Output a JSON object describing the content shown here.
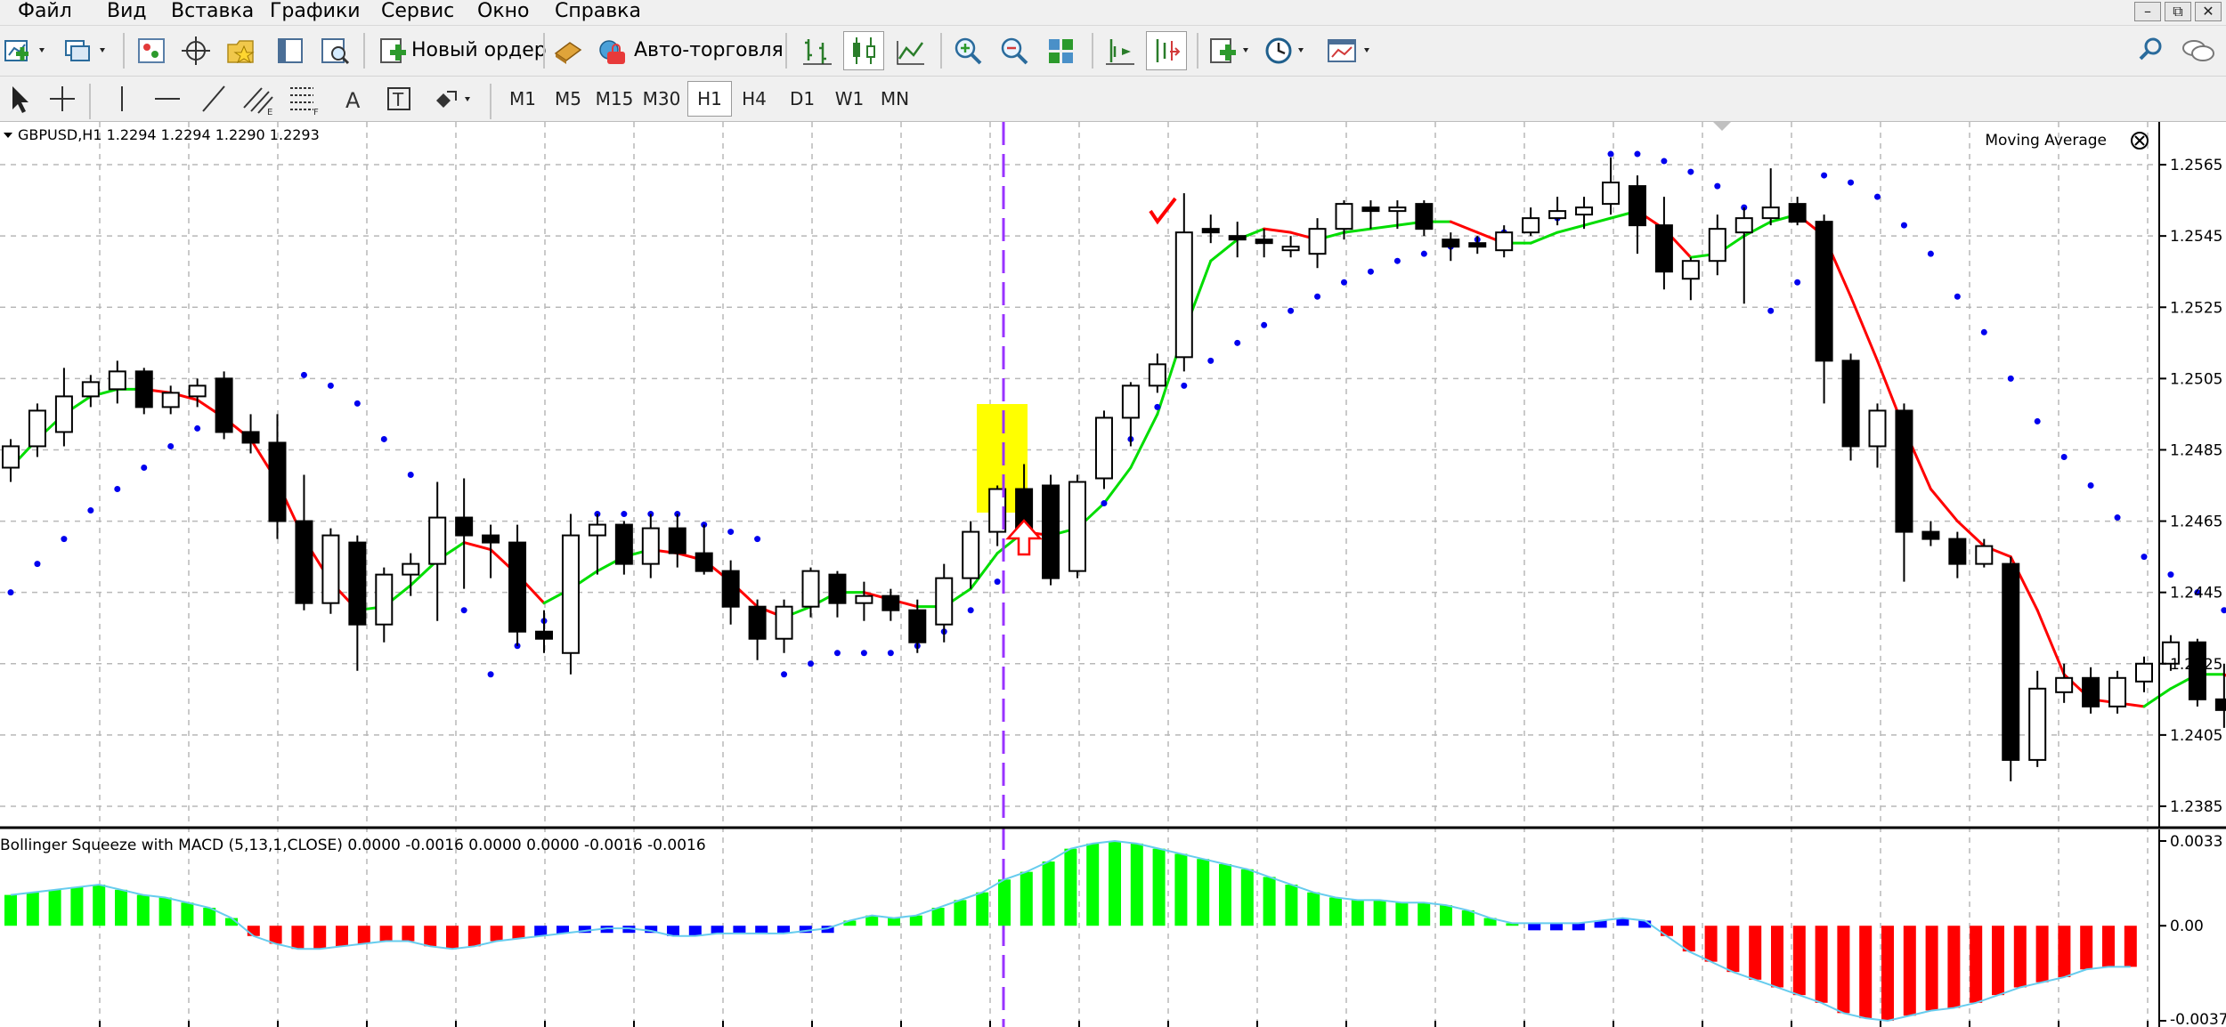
{
  "menu": [
    "Файл",
    "Вид",
    "Вставка",
    "Графики",
    "Сервис",
    "Окно",
    "Справка"
  ],
  "toolbar": {
    "new_order_label": "Новый ордер",
    "auto_trading_label": "Авто-торговля",
    "timeframes": [
      "M1",
      "M5",
      "M15",
      "M30",
      "H1",
      "H4",
      "D1",
      "W1",
      "MN"
    ],
    "active_timeframe": "H1"
  },
  "chart": {
    "symbol_info": "GBPUSD,H1  1.2294 1.2294 1.2290 1.2293",
    "indicator_label": "Moving Average",
    "price_ticks": [
      "1.2565",
      "1.2545",
      "1.2525",
      "1.2505",
      "1.2485",
      "1.2465",
      "1.2445",
      "1.2425",
      "1.2405",
      "1.2385"
    ],
    "colors": {
      "bull": "#ffffff",
      "bear": "#000000",
      "ma_up": "#00dd00",
      "ma_down": "#ff0000",
      "psar": "#0000ee",
      "vline": "#9933ff",
      "highlight": "#ffff00",
      "arrow": "#ff0000"
    }
  },
  "subchart": {
    "label": "Bollinger Squeeze with MACD (5,13,1,CLOSE) 0.0000 -0.0016 0.0000 0.0000 -0.0016 -0.0016",
    "ticks": [
      "0.0033",
      "0.00",
      "-0.0037"
    ],
    "colors": {
      "pos": "#00ff00",
      "neg": "#ff0000",
      "squeeze": "#0000ff",
      "line": "#66ccee"
    }
  },
  "chart_data": {
    "type": "candlestick",
    "ylim": [
      1.2379,
      1.2577
    ],
    "candles": [
      [
        1.248,
        1.2488,
        1.2476,
        1.2486
      ],
      [
        1.2486,
        1.2498,
        1.2483,
        1.2496
      ],
      [
        1.249,
        1.2508,
        1.2486,
        1.25
      ],
      [
        1.25,
        1.2506,
        1.2497,
        1.2504
      ],
      [
        1.2502,
        1.251,
        1.2498,
        1.2507
      ],
      [
        1.2507,
        1.2508,
        1.2495,
        1.2497
      ],
      [
        1.2497,
        1.2503,
        1.2495,
        1.2501
      ],
      [
        1.25,
        1.2505,
        1.2497,
        1.2503
      ],
      [
        1.2505,
        1.2507,
        1.2488,
        1.249
      ],
      [
        1.249,
        1.2495,
        1.2484,
        1.2487
      ],
      [
        1.2487,
        1.2495,
        1.246,
        1.2465
      ],
      [
        1.2465,
        1.2478,
        1.244,
        1.2442
      ],
      [
        1.2442,
        1.2463,
        1.2439,
        1.2461
      ],
      [
        1.2459,
        1.2461,
        1.2423,
        1.2436
      ],
      [
        1.2436,
        1.2452,
        1.2431,
        1.245
      ],
      [
        1.245,
        1.2456,
        1.2444,
        1.2453
      ],
      [
        1.2453,
        1.2476,
        1.2437,
        1.2466
      ],
      [
        1.2466,
        1.2477,
        1.2446,
        1.2461
      ],
      [
        1.2461,
        1.2464,
        1.2449,
        1.2459
      ],
      [
        1.2459,
        1.2464,
        1.243,
        1.2434
      ],
      [
        1.2434,
        1.244,
        1.2428,
        1.2432
      ],
      [
        1.2428,
        1.2467,
        1.2422,
        1.2461
      ],
      [
        1.2461,
        1.2467,
        1.245,
        1.2464
      ],
      [
        1.2464,
        1.2465,
        1.245,
        1.2453
      ],
      [
        1.2453,
        1.2467,
        1.2449,
        1.2463
      ],
      [
        1.2463,
        1.2467,
        1.2452,
        1.2456
      ],
      [
        1.2456,
        1.2464,
        1.245,
        1.2451
      ],
      [
        1.2451,
        1.2454,
        1.2436,
        1.2441
      ],
      [
        1.2441,
        1.2443,
        1.2426,
        1.2432
      ],
      [
        1.2432,
        1.2443,
        1.2428,
        1.2441
      ],
      [
        1.2441,
        1.2452,
        1.2438,
        1.2451
      ],
      [
        1.245,
        1.2451,
        1.2438,
        1.2442
      ],
      [
        1.2442,
        1.2448,
        1.2437,
        1.2444
      ],
      [
        1.2444,
        1.2446,
        1.2437,
        1.244
      ],
      [
        1.244,
        1.2443,
        1.2428,
        1.2431
      ],
      [
        1.2436,
        1.2453,
        1.2431,
        1.2449
      ],
      [
        1.2449,
        1.2465,
        1.2446,
        1.2462
      ],
      [
        1.2462,
        1.2475,
        1.2458,
        1.2474
      ],
      [
        1.2474,
        1.2481,
        1.2461,
        1.2462
      ],
      [
        1.2475,
        1.2478,
        1.2447,
        1.2449
      ],
      [
        1.2451,
        1.2478,
        1.2449,
        1.2476
      ],
      [
        1.2477,
        1.2496,
        1.2474,
        1.2494
      ],
      [
        1.2494,
        1.2504,
        1.2486,
        1.2503
      ],
      [
        1.2503,
        1.2512,
        1.2501,
        1.2509
      ],
      [
        1.2511,
        1.2557,
        1.2507,
        1.2546
      ],
      [
        1.2547,
        1.2551,
        1.2543,
        1.2546
      ],
      [
        1.2545,
        1.2549,
        1.2539,
        1.2544
      ],
      [
        1.2544,
        1.2547,
        1.2539,
        1.2543
      ],
      [
        1.2541,
        1.2545,
        1.2539,
        1.2542
      ],
      [
        1.254,
        1.255,
        1.2536,
        1.2547
      ],
      [
        1.2547,
        1.2555,
        1.2544,
        1.2554
      ],
      [
        1.2553,
        1.2555,
        1.2547,
        1.2552
      ],
      [
        1.2552,
        1.2555,
        1.2547,
        1.2553
      ],
      [
        1.2554,
        1.2555,
        1.2545,
        1.2547
      ],
      [
        1.2544,
        1.2546,
        1.2538,
        1.2542
      ],
      [
        1.2543,
        1.2545,
        1.254,
        1.2542
      ],
      [
        1.2541,
        1.2548,
        1.2539,
        1.2546
      ],
      [
        1.2546,
        1.2553,
        1.2545,
        1.255
      ],
      [
        1.255,
        1.2556,
        1.2548,
        1.2552
      ],
      [
        1.2551,
        1.2556,
        1.2547,
        1.2553
      ],
      [
        1.2554,
        1.2567,
        1.2551,
        1.256
      ],
      [
        1.2559,
        1.2562,
        1.254,
        1.2548
      ],
      [
        1.2548,
        1.2556,
        1.253,
        1.2535
      ],
      [
        1.2533,
        1.2539,
        1.2527,
        1.2538
      ],
      [
        1.2538,
        1.2551,
        1.2534,
        1.2547
      ],
      [
        1.2546,
        1.2553,
        1.2526,
        1.255
      ],
      [
        1.255,
        1.2564,
        1.2548,
        1.2553
      ],
      [
        1.2554,
        1.2556,
        1.2548,
        1.2549
      ],
      [
        1.2549,
        1.2551,
        1.2498,
        1.251
      ],
      [
        1.251,
        1.2512,
        1.2482,
        1.2486
      ],
      [
        1.2486,
        1.2498,
        1.248,
        1.2496
      ],
      [
        1.2496,
        1.2498,
        1.2448,
        1.2462
      ],
      [
        1.2462,
        1.2465,
        1.2458,
        1.246
      ],
      [
        1.246,
        1.2462,
        1.2449,
        1.2453
      ],
      [
        1.2453,
        1.246,
        1.2452,
        1.2458
      ],
      [
        1.2453,
        1.2455,
        1.2392,
        1.2398
      ],
      [
        1.2398,
        1.2423,
        1.2396,
        1.2418
      ],
      [
        1.2417,
        1.2425,
        1.2414,
        1.2421
      ],
      [
        1.2421,
        1.2424,
        1.2411,
        1.2413
      ],
      [
        1.2413,
        1.2423,
        1.2411,
        1.2421
      ],
      [
        1.242,
        1.2427,
        1.2417,
        1.2425
      ],
      [
        1.2425,
        1.2433,
        1.2423,
        1.2431
      ],
      [
        1.2431,
        1.2432,
        1.2413,
        1.2415
      ],
      [
        1.2415,
        1.2425,
        1.2407,
        1.2412
      ],
      [
        1.2412,
        1.242,
        1.238,
        1.2407
      ]
    ],
    "moving_average": [
      1.248,
      1.2488,
      1.2495,
      1.25,
      1.2502,
      1.2502,
      1.2501,
      1.2499,
      1.2494,
      1.2488,
      1.2476,
      1.246,
      1.2448,
      1.244,
      1.2441,
      1.2447,
      1.2454,
      1.2459,
      1.2457,
      1.245,
      1.2442,
      1.2446,
      1.2451,
      1.2455,
      1.2457,
      1.2456,
      1.2454,
      1.2448,
      1.2441,
      1.2438,
      1.2441,
      1.2445,
      1.2445,
      1.2443,
      1.2441,
      1.2441,
      1.2446,
      1.2456,
      1.2462,
      1.2461,
      1.2463,
      1.247,
      1.248,
      1.2495,
      1.2518,
      1.2538,
      1.2544,
      1.2547,
      1.2546,
      1.2544,
      1.2546,
      1.2547,
      1.2548,
      1.2549,
      1.2549,
      1.2546,
      1.2543,
      1.2543,
      1.2546,
      1.2548,
      1.255,
      1.2552,
      1.2547,
      1.2539,
      1.254,
      1.2545,
      1.2549,
      1.2551,
      1.2545,
      1.2528,
      1.251,
      1.2491,
      1.2474,
      1.2465,
      1.2458,
      1.2455,
      1.244,
      1.2422,
      1.2415,
      1.2414,
      1.2413,
      1.2418,
      1.2422,
      1.2422,
      1.2418,
      1.2412
    ],
    "psar": [
      1.2445,
      1.2453,
      1.246,
      1.2468,
      1.2474,
      1.248,
      1.2486,
      1.2491,
      1.2495,
      null,
      null,
      1.2506,
      1.2503,
      1.2498,
      1.2488,
      1.2478,
      1.2462,
      1.244,
      1.2422,
      1.243,
      1.2437,
      1.2444,
      1.2467,
      1.2467,
      1.2467,
      1.2467,
      1.2464,
      1.2462,
      1.246,
      1.2422,
      1.2425,
      1.2428,
      1.2428,
      1.2428,
      1.243,
      1.2434,
      1.244,
      1.2448,
      1.2457,
      1.2462,
      1.2466,
      1.247,
      1.2488,
      1.2497,
      1.2503,
      1.251,
      1.2515,
      1.252,
      1.2524,
      1.2528,
      1.2532,
      1.2535,
      1.2538,
      1.254,
      1.2542,
      1.2544,
      1.2546,
      1.2548,
      1.255,
      1.2552,
      1.2568,
      1.2568,
      1.2566,
      1.2563,
      1.2559,
      1.2553,
      1.2524,
      1.2532,
      1.2562,
      1.256,
      1.2556,
      1.2548,
      1.254,
      1.2528,
      1.2518,
      1.2505,
      1.2493,
      1.2483,
      1.2475,
      1.2466,
      1.2455,
      1.245,
      1.2445,
      1.244,
      1.2437,
      1.2433
    ],
    "macd_hist": [
      0.0012,
      0.0013,
      0.0014,
      0.0015,
      0.0016,
      0.0014,
      0.0012,
      0.0011,
      0.0009,
      0.0007,
      0.0003,
      -0.0004,
      -0.0007,
      -0.0009,
      -0.0009,
      -0.0008,
      -0.0007,
      -0.0006,
      -0.0006,
      -0.0008,
      -0.0009,
      -0.0008,
      -0.0006,
      -0.0005,
      -0.0004,
      -0.0003,
      -0.0002,
      -0.0001,
      -0.0001,
      -0.0002,
      -0.0004,
      -0.0004,
      -0.0003,
      -0.0003,
      -0.0003,
      -0.0003,
      -0.0002,
      -0.0001,
      0.0002,
      0.0004,
      0.0003,
      0.0004,
      0.0007,
      0.001,
      0.0013,
      0.0018,
      0.0021,
      0.0025,
      0.003,
      0.0032,
      0.0033,
      0.0032,
      0.003,
      0.0028,
      0.0026,
      0.0024,
      0.0022,
      0.0019,
      0.0016,
      0.0013,
      0.0011,
      0.001,
      0.001,
      0.0009,
      0.0009,
      0.0008,
      0.0006,
      0.0003,
      0.0001,
      0.0001,
      0.0001,
      0.0001,
      0.0002,
      0.0003,
      0.0002,
      -0.0004,
      -0.001,
      -0.0014,
      -0.0018,
      -0.0021,
      -0.0024,
      -0.0027,
      -0.003,
      -0.0034,
      -0.0036,
      -0.0037,
      -0.0035,
      -0.0033,
      -0.0032,
      -0.003,
      -0.0027,
      -0.0024,
      -0.0022,
      -0.002,
      -0.0017,
      -0.0016,
      -0.0016
    ],
    "hist_ylim": [
      -0.0037,
      0.0033
    ]
  }
}
